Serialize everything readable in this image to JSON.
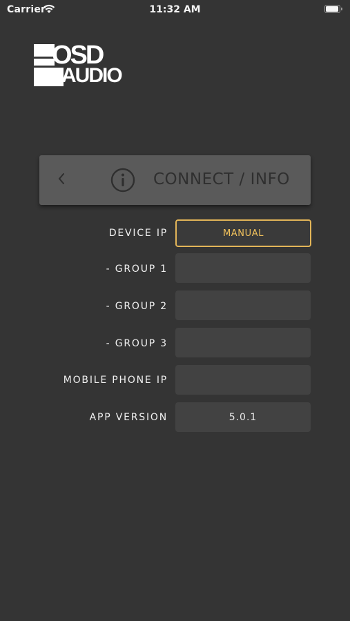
{
  "status_bar": {
    "carrier": "Carrier",
    "time": "11:32 AM",
    "battery_level": 1.0
  },
  "logo": {
    "line1": "OSD",
    "line2": "AUDIO"
  },
  "header": {
    "title": "CONNECT / INFO",
    "back_icon": "chevron-left-icon",
    "info_icon": "info-circle-icon"
  },
  "rows": [
    {
      "label": "DEVICE IP",
      "value": "MANUAL"
    },
    {
      "label": "- GROUP 1",
      "value": ""
    },
    {
      "label": "- GROUP 2",
      "value": ""
    },
    {
      "label": "- GROUP 3",
      "value": ""
    },
    {
      "label": "MOBILE PHONE IP",
      "value": ""
    },
    {
      "label": "APP VERSION",
      "value": "5.0.1"
    }
  ],
  "colors": {
    "background": "#343434",
    "header_card": "#5a5a5a",
    "field": "#424242",
    "accent": "#e3b558"
  }
}
